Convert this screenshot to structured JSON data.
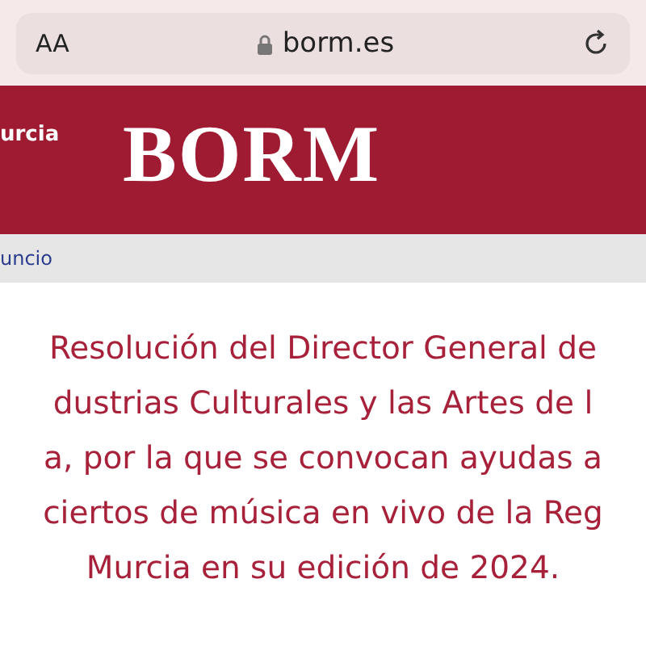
{
  "browser": {
    "text_size_button": "AA",
    "url": "borm.es"
  },
  "header": {
    "region_text": "urcia",
    "logo": "BORM"
  },
  "breadcrumb": {
    "link": "uncio"
  },
  "title_lines": [
    "Resolución del Director General de",
    "dustrias Culturales y las Artes de l",
    "a, por la que se convocan ayudas a",
    "ciertos de música en vivo de la Reg",
    "Murcia en su edición de 2024."
  ]
}
